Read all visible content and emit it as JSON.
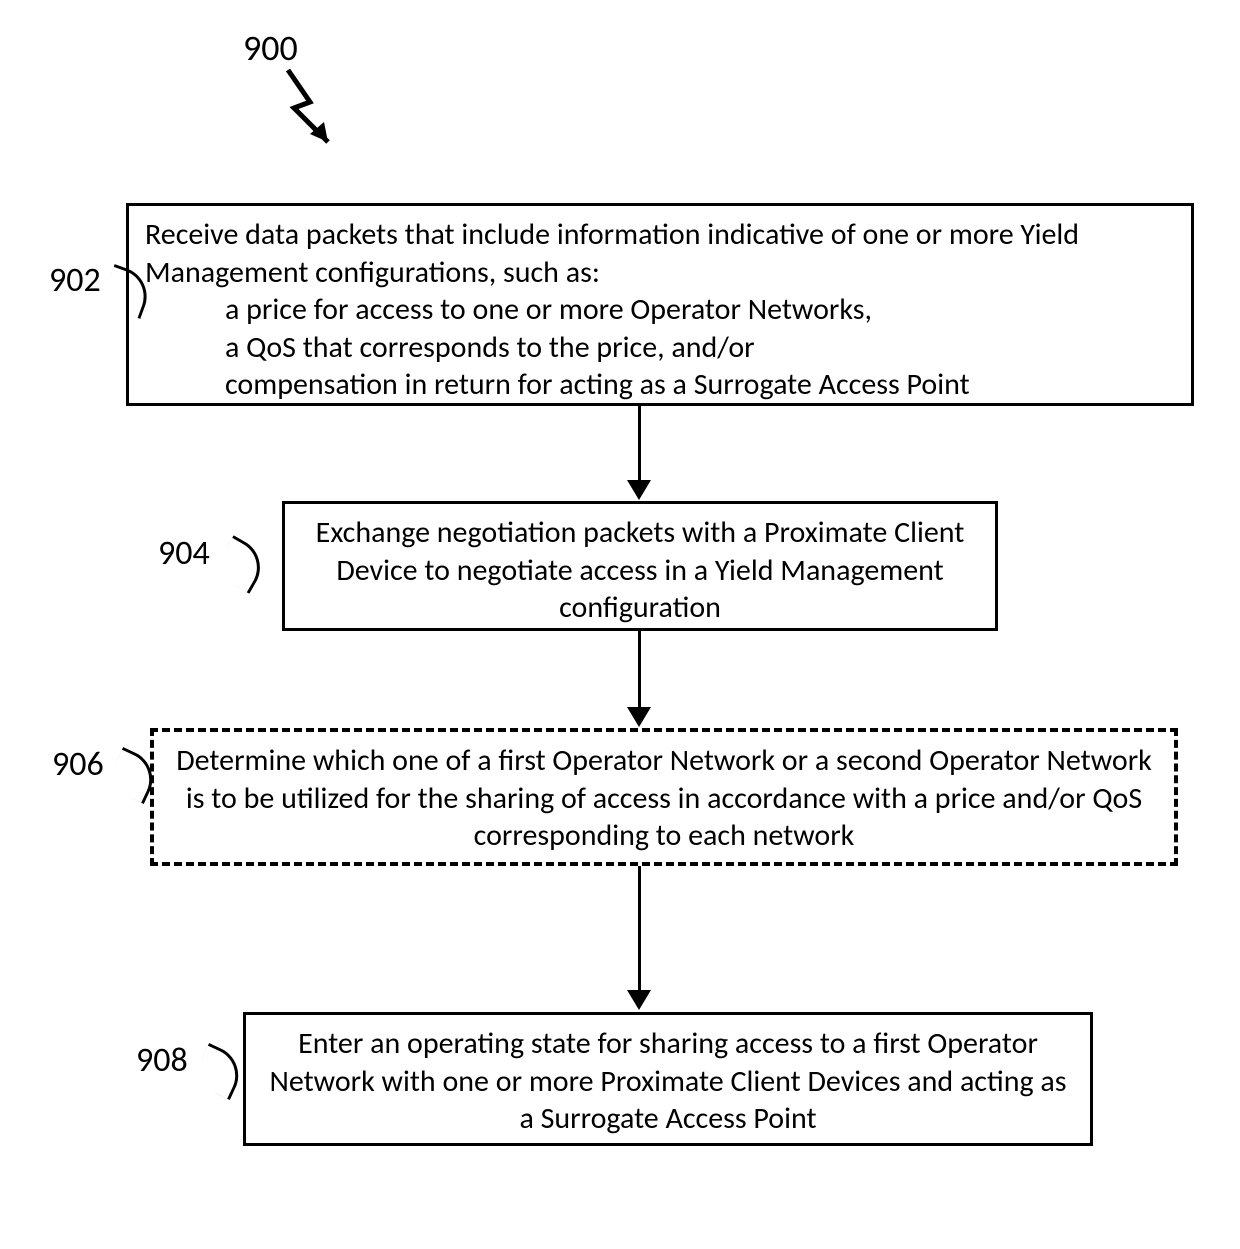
{
  "figure_number": "900",
  "steps": [
    {
      "id": "902",
      "intro": "Receive data packets that include information indicative of one or more Yield Management configurations, such as:",
      "bullets": [
        "a price for access to one or more Operator Networks,",
        "a QoS that corresponds to the price, and/or",
        "compensation in return for acting as a Surrogate Access Point"
      ]
    },
    {
      "id": "904",
      "text": "Exchange negotiation packets with a Proximate Client Device to negotiate access in a Yield Management configuration"
    },
    {
      "id": "906",
      "text": "Determine which one of a first Operator Network or a second Operator Network is to be utilized for the sharing of access in accordance with a price and/or QoS corresponding to each network"
    },
    {
      "id": "908",
      "text": "Enter an operating state for sharing access to a first Operator Network with one or more Proximate Client Devices and acting as a Surrogate Access Point"
    }
  ]
}
